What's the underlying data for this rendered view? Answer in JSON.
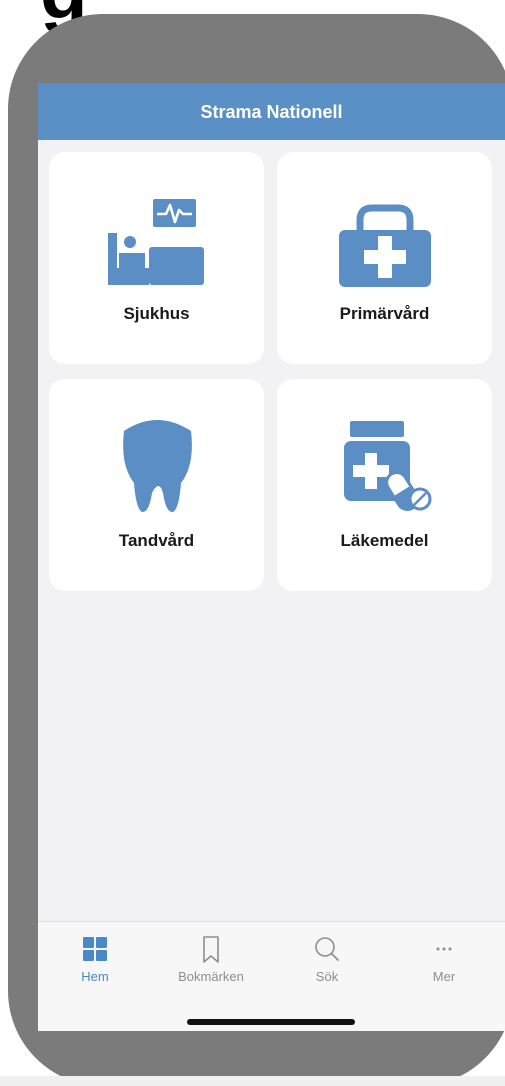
{
  "header_fragment": "g",
  "app": {
    "title": "Strama Nationell"
  },
  "categories": [
    {
      "label": "Sjukhus",
      "icon": "hospital-bed-icon"
    },
    {
      "label": "Primärvård",
      "icon": "medical-kit-icon"
    },
    {
      "label": "Tandvård",
      "icon": "tooth-icon"
    },
    {
      "label": "Läkemedel",
      "icon": "medicine-bottle-icon"
    }
  ],
  "tabs": [
    {
      "label": "Hem",
      "icon": "grid-icon",
      "active": true
    },
    {
      "label": "Bokmärken",
      "icon": "bookmark-icon",
      "active": false
    },
    {
      "label": "Sök",
      "icon": "search-icon",
      "active": false
    },
    {
      "label": "Mer",
      "icon": "more-icon",
      "active": false
    }
  ],
  "colors": {
    "accent": "#5a90c6",
    "icon": "#5b8ec4",
    "phone_frame": "#7b7b7b",
    "screen_bg": "#f2f1f3"
  }
}
